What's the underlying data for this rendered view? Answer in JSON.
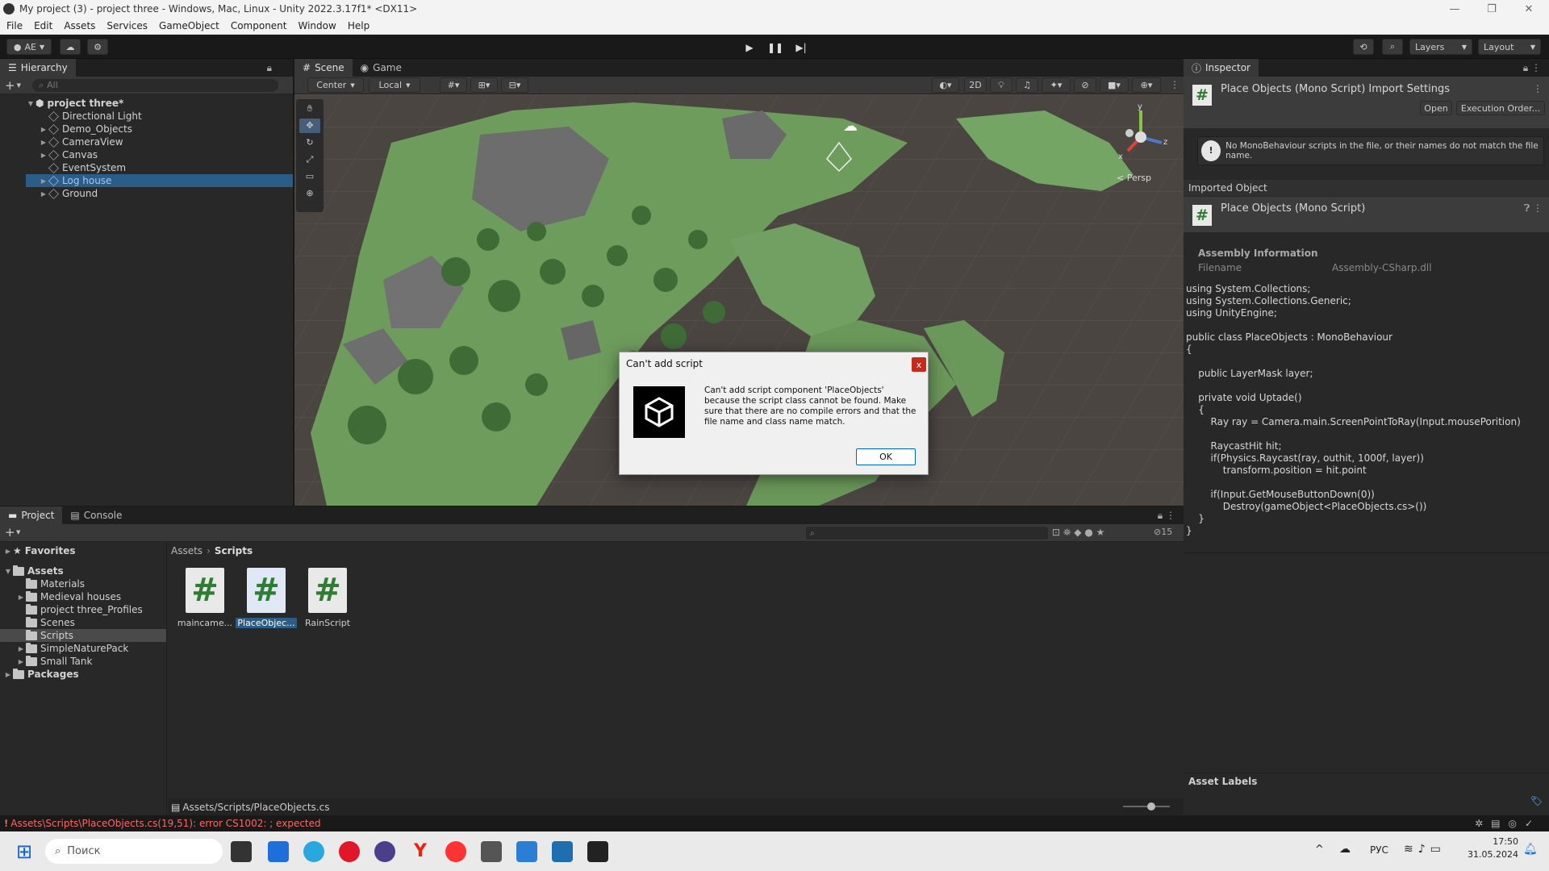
{
  "window": {
    "title": "My project (3) - project three - Windows, Mac, Linux - Unity 2022.3.17f1* <DX11>"
  },
  "menu": [
    "File",
    "Edit",
    "Assets",
    "Services",
    "GameObject",
    "Component",
    "Window",
    "Help"
  ],
  "toolbar": {
    "account": "AE",
    "layers": "Layers",
    "layout": "Layout"
  },
  "hierarchy": {
    "tab": "Hierarchy",
    "search_placeholder": "All",
    "root": "project three*",
    "items": [
      "Directional Light",
      "Demo_Objects",
      "CameraView",
      "Canvas",
      "EventSystem",
      "Log house",
      "Ground"
    ]
  },
  "scene": {
    "tabs": [
      "Scene",
      "Game"
    ],
    "pivot": "Center",
    "space": "Local",
    "mode2d": "2D",
    "persp": "< Persp",
    "axis": {
      "y": "y",
      "z": "z",
      "x": "x"
    }
  },
  "dialog": {
    "title": "Can't add script",
    "message": "Can't add script component 'PlaceObjects' because the script class cannot be found. Make sure that there are no compile errors and that the file name and class name match.",
    "ok": "OK",
    "close": "x"
  },
  "inspector": {
    "tab": "Inspector",
    "header_title": "Place Objects (Mono Script) Import Settings",
    "open": "Open",
    "execution_order": "Execution Order...",
    "warning": "No MonoBehaviour scripts in the file, or their names do not match the file name.",
    "imported_object": "Imported Object",
    "script_name": "Place Objects (Mono Script)",
    "assembly_info": "Assembly Information",
    "filename_label": "Filename",
    "filename_value": "Assembly-CSharp.dll",
    "code": "using System.Collections;\nusing System.Collections.Generic;\nusing UnityEngine;\n\npublic class PlaceObjects : MonoBehaviour\n{\n\n    public LayerMask layer;\n\n    private void Uptade()\n    {\n        Ray ray = Camera.main.ScreenPointToRay(Input.mousePorition)\n\n        RaycastHit hit;\n        if(Physics.Raycast(ray, outhit, 1000f, layer))\n            transform.position = hit.point\n\n        if(Input.GetMouseButtonDown(0))\n            Destroy(gameObject<PlaceObjects.cs>())\n    }\n}",
    "asset_labels": "Asset Labels"
  },
  "project": {
    "tabs": [
      "Project",
      "Console"
    ],
    "favorites": "Favorites",
    "assets": "Assets",
    "folders": [
      "Materials",
      "Medieval houses",
      "project three_Profiles",
      "Scenes",
      "Scripts",
      "SimpleNaturePack",
      "Small Tank"
    ],
    "packages": "Packages",
    "breadcrumb": [
      "Assets",
      "Scripts"
    ],
    "files": [
      "maincame...",
      "PlaceObjec...",
      "RainScript"
    ],
    "hidden_count": "15",
    "path": "Assets/Scripts/PlaceObjects.cs"
  },
  "status": {
    "error": "Assets\\Scripts\\PlaceObjects.cs(19,51): error CS1002: ; expected"
  },
  "taskbar": {
    "search": "Поиск",
    "lang": "РУС",
    "time": "17:50",
    "date": "31.05.2024"
  },
  "colors": {
    "accent": "#2c5d87",
    "error": "#ff6666",
    "ground": "#6b9a5a"
  }
}
